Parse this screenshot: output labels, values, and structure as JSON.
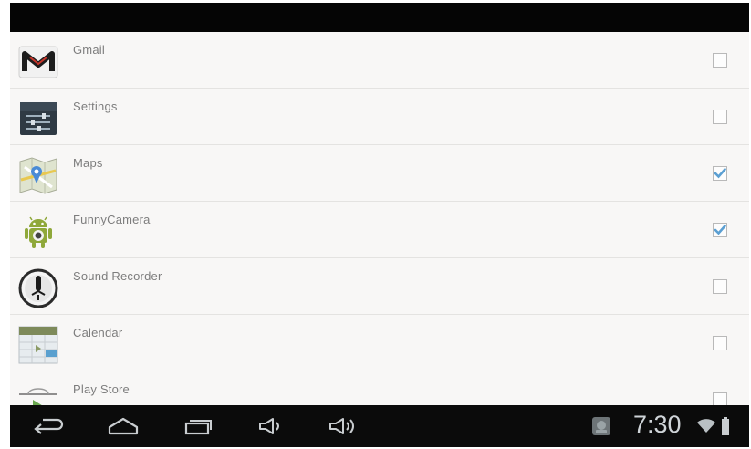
{
  "apps": [
    {
      "name": "Gmail",
      "icon": "gmail-icon",
      "checked": false
    },
    {
      "name": "Settings",
      "icon": "settings-icon",
      "checked": false
    },
    {
      "name": "Maps",
      "icon": "maps-icon",
      "checked": true
    },
    {
      "name": "FunnyCamera",
      "icon": "android-icon",
      "checked": true
    },
    {
      "name": "Sound Recorder",
      "icon": "microphone-icon",
      "checked": false
    },
    {
      "name": "Calendar",
      "icon": "calendar-icon",
      "checked": false
    },
    {
      "name": "Play Store",
      "icon": "play-store-icon",
      "checked": false
    }
  ],
  "status": {
    "time": "7:30"
  },
  "colors": {
    "check": "#5b9fd2",
    "navbar": "#0b0b0b",
    "topbar": "#050505"
  }
}
